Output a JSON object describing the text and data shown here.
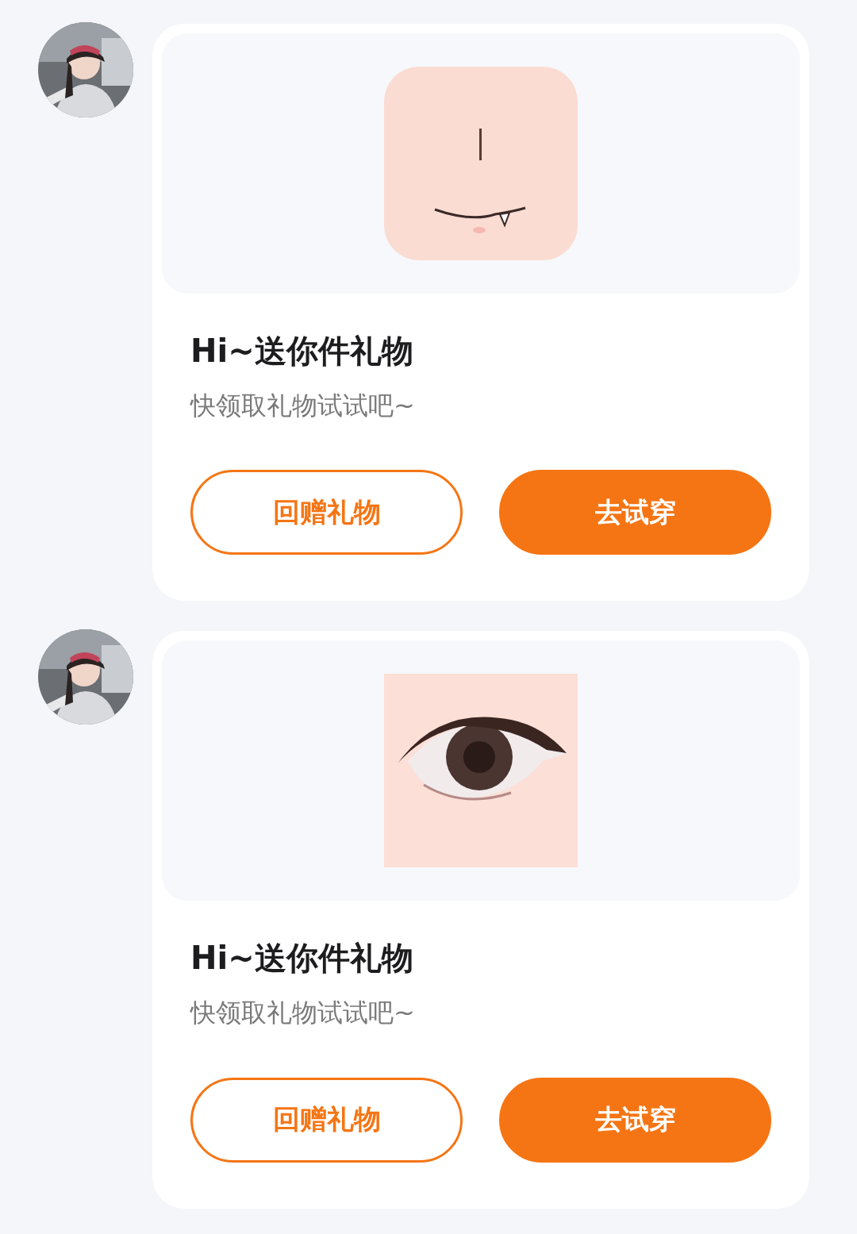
{
  "messages": [
    {
      "item": {
        "kind": "mouth"
      },
      "title": "Hi~送你件礼物",
      "subtitle": "快领取礼物试试吧~",
      "buttons": [
        {
          "label": "回赠礼物",
          "kind": "outline"
        },
        {
          "label": "去试穿",
          "kind": "filled"
        }
      ]
    },
    {
      "item": {
        "kind": "eye"
      },
      "title": "Hi~送你件礼物",
      "subtitle": "快领取礼物试试吧~",
      "buttons": [
        {
          "label": "回赠礼物",
          "kind": "outline"
        },
        {
          "label": "去试穿",
          "kind": "filled"
        }
      ]
    }
  ]
}
